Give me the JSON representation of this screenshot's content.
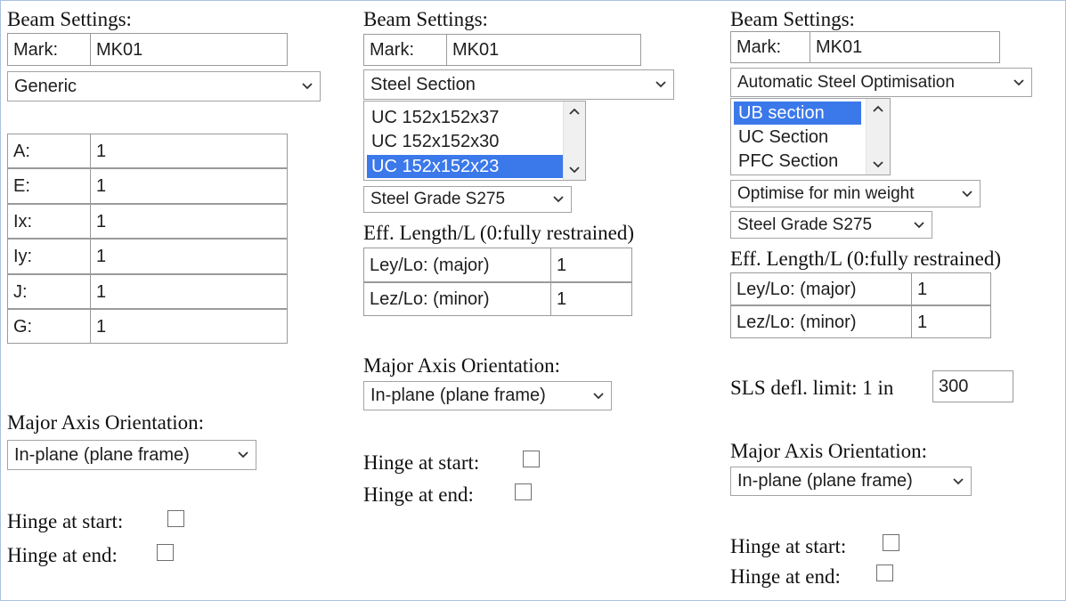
{
  "col1": {
    "heading": "Beam Settings:",
    "mark_label": "Mark:",
    "mark_value": "MK01",
    "type_select": "Generic",
    "props": [
      {
        "label": "A:",
        "value": "1"
      },
      {
        "label": "E:",
        "value": "1"
      },
      {
        "label": "Ix:",
        "value": "1"
      },
      {
        "label": "Iy:",
        "value": "1"
      },
      {
        "label": "J:",
        "value": "1"
      },
      {
        "label": "G:",
        "value": "1"
      }
    ],
    "orientation_heading": "Major Axis Orientation:",
    "orientation_select": "In-plane (plane frame)",
    "hinge_start": "Hinge at start:",
    "hinge_end": "Hinge at end:"
  },
  "col2": {
    "heading": "Beam Settings:",
    "mark_label": "Mark:",
    "mark_value": "MK01",
    "type_select": "Steel Section",
    "sections": [
      "UC 152x152x37",
      "UC 152x152x30",
      "UC 152x152x23"
    ],
    "grade_select": "Steel Grade S275",
    "eff_heading": "Eff. Length/L (0:fully restrained)",
    "ley_label": "Ley/Lo: (major)",
    "ley_value": "1",
    "lez_label": "Lez/Lo: (minor)",
    "lez_value": "1",
    "orientation_heading": "Major Axis Orientation:",
    "orientation_select": "In-plane (plane frame)",
    "hinge_start": "Hinge at start:",
    "hinge_end": "Hinge at end:"
  },
  "col3": {
    "heading": "Beam Settings:",
    "mark_label": "Mark:",
    "mark_value": "MK01",
    "type_select": "Automatic Steel Optimisation",
    "section_types": [
      "UB section",
      "UC Section",
      "PFC Section"
    ],
    "optimise_select": "Optimise for min weight",
    "grade_select": "Steel Grade S275",
    "eff_heading": "Eff. Length/L (0:fully restrained)",
    "ley_label": "Ley/Lo: (major)",
    "ley_value": "1",
    "lez_label": "Lez/Lo: (minor)",
    "lez_value": "1",
    "sls_label": "SLS defl. limit: 1 in",
    "sls_value": "300",
    "orientation_heading": "Major Axis Orientation:",
    "orientation_select": "In-plane (plane frame)",
    "hinge_start": "Hinge at start:",
    "hinge_end": "Hinge at end:"
  },
  "colors": {
    "selection": "#3b78ea",
    "border": "#a3a3a3",
    "frame": "#a9c1e3"
  }
}
